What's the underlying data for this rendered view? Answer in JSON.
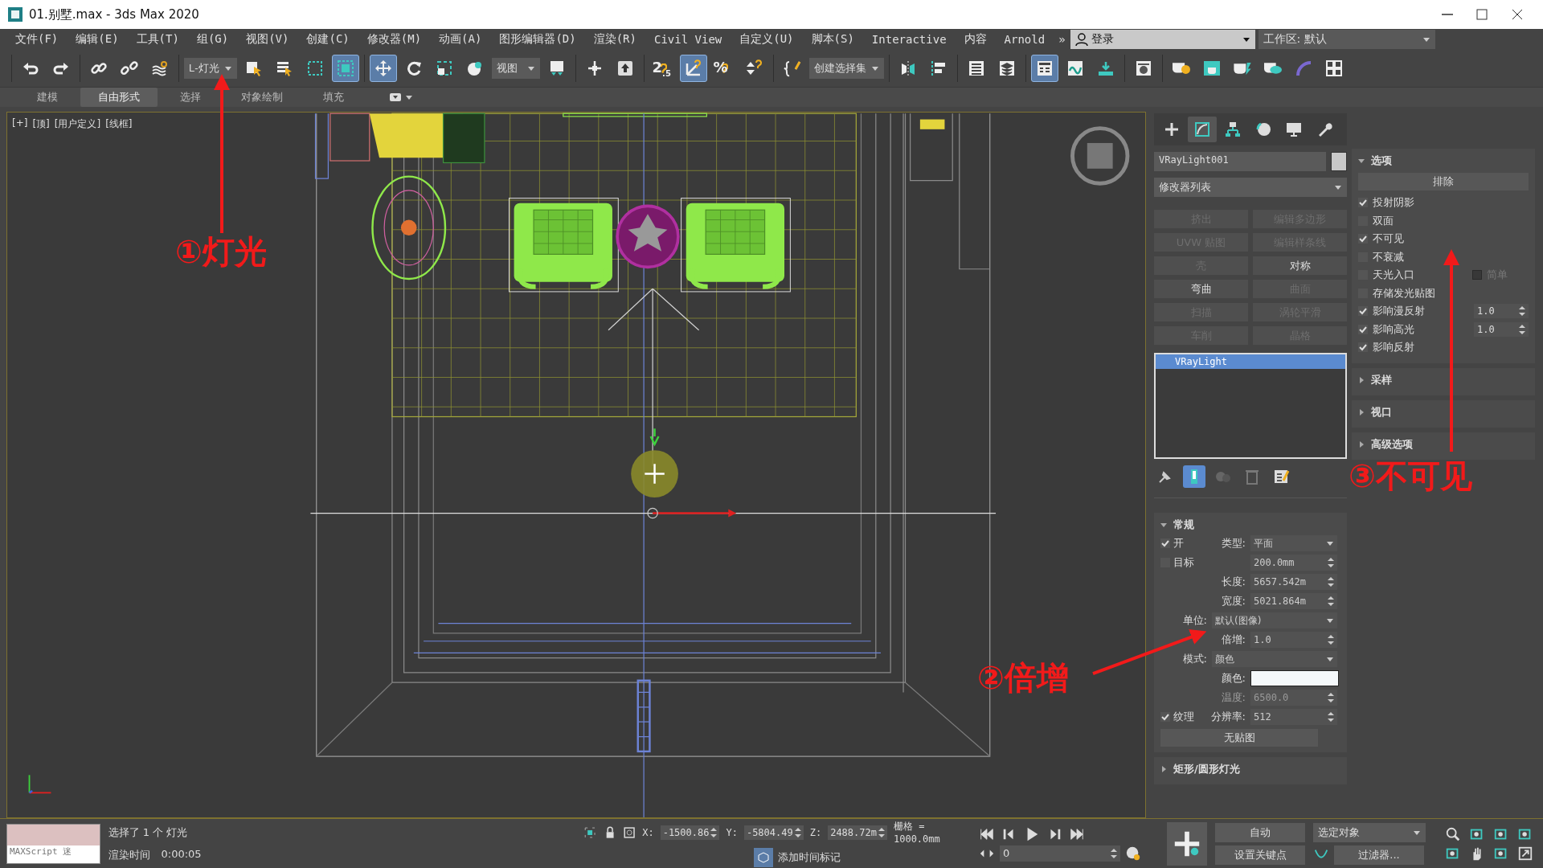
{
  "window": {
    "title": "01.别墅.max - 3ds Max 2020"
  },
  "menu": [
    "文件(F)",
    "编辑(E)",
    "工具(T)",
    "组(G)",
    "视图(V)",
    "创建(C)",
    "修改器(M)",
    "动画(A)",
    "图形编辑器(D)",
    "渲染(R)",
    "Civil View",
    "自定义(U)",
    "脚本(S)",
    "Interactive",
    "内容",
    "Arnold"
  ],
  "menu_overflow": "»",
  "account": {
    "label": "登录"
  },
  "workspace": {
    "label": "工作区: 默认"
  },
  "toolbar": {
    "groups": [
      [
        {
          "kind": "undo",
          "selected": false
        },
        {
          "kind": "redo",
          "selected": false
        }
      ],
      [
        {
          "kind": "link",
          "selected": false
        },
        {
          "kind": "unlink",
          "selected": false
        },
        {
          "kind": "bind",
          "selected": false
        }
      ],
      [
        {
          "kind": "dropdown",
          "value": "L-灯光"
        },
        {
          "kind": "select",
          "selected": false
        },
        {
          "kind": "select-by-name",
          "selected": false
        },
        {
          "kind": "region",
          "selected": false
        },
        {
          "kind": "window-crossing",
          "selected": true
        }
      ],
      [
        {
          "kind": "move",
          "selected": true
        },
        {
          "kind": "rotate",
          "selected": false
        },
        {
          "kind": "scale",
          "selected": false
        },
        {
          "kind": "place",
          "selected": false
        },
        {
          "kind": "dropdown",
          "value": "视图"
        },
        {
          "kind": "pivot",
          "selected": false
        }
      ],
      [
        {
          "kind": "manipulate",
          "selected": false
        },
        {
          "kind": "keyboard",
          "selected": false
        }
      ],
      [
        {
          "kind": "snap",
          "label": "2$_{.5}$",
          "selected": false
        },
        {
          "kind": "angle-snap",
          "selected": true
        },
        {
          "kind": "percent-snap",
          "label": "%",
          "selected": false
        },
        {
          "kind": "spinner-snap",
          "selected": false
        }
      ],
      [
        {
          "kind": "edit-named",
          "selected": false
        },
        {
          "kind": "dropdown",
          "value": "创建选择集"
        }
      ],
      [
        {
          "kind": "mirror",
          "selected": false
        },
        {
          "kind": "align",
          "selected": false
        }
      ],
      [
        {
          "kind": "list",
          "selected": false
        },
        {
          "kind": "layers",
          "selected": false
        }
      ],
      [
        {
          "kind": "toolbox",
          "selected": true
        },
        {
          "kind": "curve",
          "selected": false
        },
        {
          "kind": "schematic",
          "selected": false
        }
      ],
      [
        {
          "kind": "material",
          "selected": false
        }
      ],
      [
        {
          "kind": "render-setup",
          "selected": false
        },
        {
          "kind": "frame-window",
          "selected": false
        },
        {
          "kind": "render",
          "selected": false
        },
        {
          "kind": "render-cloud",
          "selected": false
        },
        {
          "kind": "arc",
          "selected": false
        },
        {
          "kind": "grid",
          "selected": false
        }
      ]
    ]
  },
  "ribbon_tabs": [
    {
      "label": "建模",
      "selected": false
    },
    {
      "label": "自由形式",
      "selected": true
    },
    {
      "label": "选择",
      "selected": false
    },
    {
      "label": "对象绘制",
      "selected": false
    },
    {
      "label": "填充",
      "selected": false
    }
  ],
  "viewport": {
    "labels": [
      "[+]",
      "[顶]",
      "[用户定义]",
      "[线框]"
    ]
  },
  "annotations": [
    {
      "text": "①灯光"
    },
    {
      "text": "②倍增"
    },
    {
      "text": "③不可见"
    }
  ],
  "command_panel": {
    "tabs": [
      {
        "kind": "create",
        "selected": false
      },
      {
        "kind": "modify",
        "selected": true
      },
      {
        "kind": "hierarchy",
        "selected": false
      },
      {
        "kind": "motion",
        "selected": false
      },
      {
        "kind": "display",
        "selected": false
      },
      {
        "kind": "utilities",
        "selected": false
      }
    ],
    "object": {
      "name": "VRayLight001",
      "color": "#c8c8c8"
    },
    "modifier_list": "修改器列表",
    "modifier_buttons": [
      {
        "label": "挤出",
        "disabled": true
      },
      {
        "label": "编辑多边形",
        "disabled": true
      },
      {
        "label": "UVW 贴图",
        "disabled": true
      },
      {
        "label": "编辑样条线",
        "disabled": true
      },
      {
        "label": "壳",
        "disabled": true
      },
      {
        "label": "对称",
        "disabled": false
      },
      {
        "label": "弯曲",
        "disabled": false
      },
      {
        "label": "曲面",
        "disabled": true
      },
      {
        "label": "扫描",
        "disabled": true
      },
      {
        "label": "涡轮平滑",
        "disabled": true
      },
      {
        "label": "车削",
        "disabled": true
      },
      {
        "label": "晶格",
        "disabled": true
      }
    ],
    "stack": [
      {
        "label": "VRayLight",
        "selected": true
      }
    ],
    "stack_tools": [
      {
        "kind": "pin",
        "selected": false
      },
      {
        "kind": "end-result",
        "selected": true
      },
      {
        "kind": "unique",
        "selected": false
      },
      {
        "kind": "remove",
        "selected": false
      },
      {
        "kind": "configure",
        "selected": false
      }
    ],
    "general": {
      "title": "常规",
      "expanded": true,
      "rows": [
        {
          "check": {
            "label": "开",
            "checked": true
          },
          "label": "类型:",
          "kind": "dropdown",
          "value": "平面",
          "disabled": false
        },
        {
          "check": {
            "label": "目标",
            "checked": false
          },
          "kind": "spinner",
          "value": "200.0mm",
          "disabled": false
        },
        {
          "label": "长度:",
          "kind": "spinner",
          "value": "5657.542m",
          "disabled": false
        },
        {
          "label": "宽度:",
          "kind": "spinner",
          "value": "5021.864m",
          "disabled": false
        },
        {
          "label": "单位:",
          "kind": "wide-dropdown",
          "value": "默认(图像)",
          "disabled": false
        },
        {
          "label": "倍增:",
          "kind": "spinner",
          "value": "1.0",
          "disabled": false
        },
        {
          "label": "模式:",
          "kind": "wide-dropdown",
          "value": "颜色",
          "disabled": false
        },
        {
          "label": "颜色:",
          "kind": "color",
          "color": "#f4f8fa",
          "disabled": false
        },
        {
          "label": "温度:",
          "kind": "spinner",
          "value": "6500.0",
          "disabled": true
        },
        {
          "check": {
            "label": "纹理",
            "checked": true
          },
          "label": "分辨率:",
          "kind": "spinner",
          "value": "512",
          "disabled": false
        },
        {
          "kind": "button",
          "value": "无贴图",
          "disabled": false
        }
      ]
    },
    "general_after": [
      {
        "title": "矩形/圆形灯光",
        "expanded": false
      }
    ],
    "options": {
      "title": "选项",
      "expanded": true,
      "exclude": "排除",
      "checks": [
        {
          "label": "投射阴影",
          "checked": true
        },
        {
          "label": "双面",
          "checked": false
        },
        {
          "label": "不可见",
          "checked": true
        },
        {
          "label": "不衰减",
          "checked": false
        },
        {
          "label": "天光入口",
          "checked": false,
          "extra": {
            "label": "简单",
            "checked": false
          }
        },
        {
          "label": "存储发光贴图",
          "checked": false
        },
        {
          "label": "影响漫反射",
          "checked": true,
          "value": "1.0"
        },
        {
          "label": "影响高光",
          "checked": true,
          "value": "1.0"
        },
        {
          "label": "影响反射",
          "checked": true
        }
      ]
    },
    "options_after": [
      {
        "title": "采样",
        "expanded": false
      },
      {
        "title": "视口",
        "expanded": false
      },
      {
        "title": "高级选项",
        "expanded": false
      }
    ]
  },
  "status": {
    "maxscript": "MAXScript 迷",
    "prompt": "选择了 1 个 灯光",
    "render_time_label": "渲染时间",
    "render_time": "0:00:05",
    "coords": [
      {
        "label": "X:",
        "value": "-1500.86"
      },
      {
        "label": "Y:",
        "value": "-5804.49"
      },
      {
        "label": "Z:",
        "value": "2488.72m"
      }
    ],
    "grid": "栅格 = 1000.0mm",
    "time_tag": "添加时间标记",
    "frame": "0",
    "auto_key": "自动",
    "set_key": "设置关键点",
    "key_filter": "选定对象",
    "filters": "过滤器..."
  }
}
